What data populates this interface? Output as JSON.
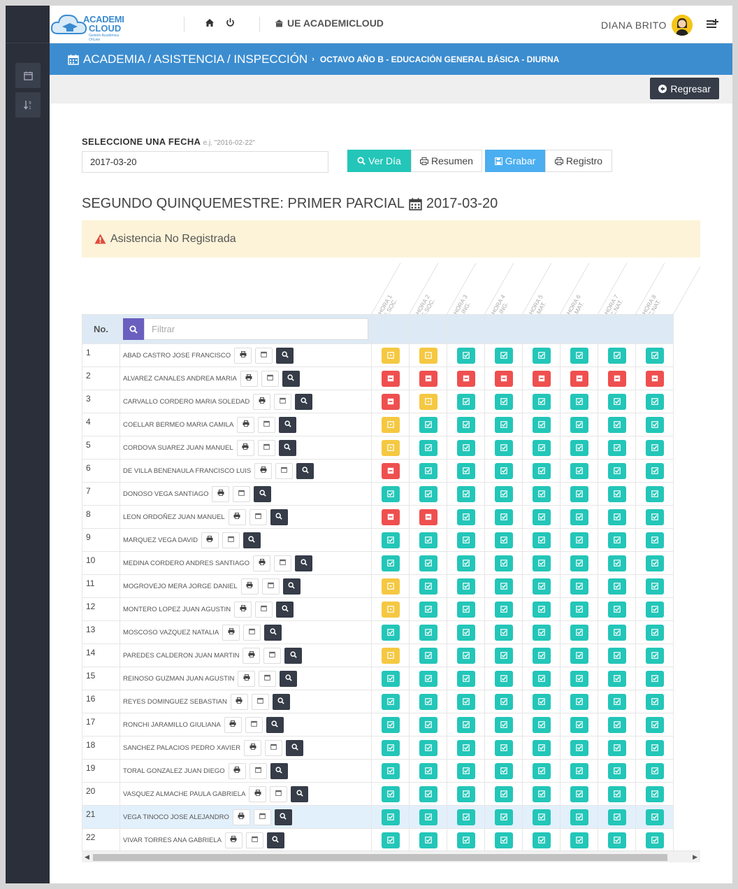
{
  "app": {
    "logo_line1": "ACADEMI",
    "logo_line2": "CLOUD",
    "logo_tagline": "Gestión Académica OnLine",
    "brand": "UE ACADEMICLOUD",
    "user": "DIANA BRITO"
  },
  "breadcrumb": {
    "main": "ACADEMIA / ASISTENCIA / INSPECCIÓN",
    "sub": "OCTAVO AÑO B - EDUCACIÓN GENERAL BÁSICA - DIURNA"
  },
  "toolbar": {
    "back_label": "Regresar"
  },
  "date_select": {
    "label": "SELECCIONE UNA FECHA",
    "hint": "e.j. \"2016-02-22\"",
    "value": "2017-03-20"
  },
  "buttons": {
    "ver_dia": "Ver Día",
    "resumen": "Resumen",
    "grabar": "Grabar",
    "registro": "Registro"
  },
  "section": {
    "title": "SEGUNDO QUINQUEMESTRE: PRIMER PARCIAL",
    "date": "2017-03-20"
  },
  "alert": {
    "text": "Asistencia No Registrada"
  },
  "table": {
    "col_no": "No.",
    "filter_placeholder": "Filtrar",
    "hours": [
      {
        "h": "HORA 1",
        "s": "E.SOC."
      },
      {
        "h": "HORA 2",
        "s": "E.SOC."
      },
      {
        "h": "HORA 3",
        "s": "ING."
      },
      {
        "h": "HORA 4",
        "s": "ING."
      },
      {
        "h": "HORA 5",
        "s": "MAT."
      },
      {
        "h": "HORA 6",
        "s": "MAT."
      },
      {
        "h": "HORA 7",
        "s": "C.NAT."
      },
      {
        "h": "HORA 8",
        "s": "C.NAT."
      }
    ],
    "rows": [
      {
        "no": "1",
        "name": "ABAD CASTRO JOSE FRANCISCO",
        "status": [
          "late",
          "late",
          "ok",
          "ok",
          "ok",
          "ok",
          "ok",
          "ok"
        ]
      },
      {
        "no": "2",
        "name": "ALVAREZ CANALES ANDREA MARIA",
        "status": [
          "abs",
          "abs",
          "abs",
          "abs",
          "abs",
          "abs",
          "abs",
          "abs"
        ]
      },
      {
        "no": "3",
        "name": "CARVALLO CORDERO MARIA SOLEDAD",
        "status": [
          "abs",
          "late",
          "ok",
          "ok",
          "ok",
          "ok",
          "ok",
          "ok"
        ]
      },
      {
        "no": "4",
        "name": "COELLAR BERMEO MARIA CAMILA",
        "status": [
          "late",
          "ok",
          "ok",
          "ok",
          "ok",
          "ok",
          "ok",
          "ok"
        ]
      },
      {
        "no": "5",
        "name": "CORDOVA SUAREZ JUAN MANUEL",
        "status": [
          "late",
          "ok",
          "ok",
          "ok",
          "ok",
          "ok",
          "ok",
          "ok"
        ]
      },
      {
        "no": "6",
        "name": "DE VILLA BENENAULA FRANCISCO LUIS",
        "status": [
          "abs",
          "ok",
          "ok",
          "ok",
          "ok",
          "ok",
          "ok",
          "ok"
        ]
      },
      {
        "no": "7",
        "name": "DONOSO VEGA SANTIAGO",
        "status": [
          "ok",
          "ok",
          "ok",
          "ok",
          "ok",
          "ok",
          "ok",
          "ok"
        ]
      },
      {
        "no": "8",
        "name": "LEON ORDOÑEZ JUAN MANUEL",
        "status": [
          "abs",
          "abs",
          "ok",
          "ok",
          "ok",
          "ok",
          "ok",
          "ok"
        ]
      },
      {
        "no": "9",
        "name": "MARQUEZ VEGA DAVID",
        "status": [
          "ok",
          "ok",
          "ok",
          "ok",
          "ok",
          "ok",
          "ok",
          "ok"
        ]
      },
      {
        "no": "10",
        "name": "MEDINA CORDERO ANDRES SANTIAGO",
        "status": [
          "ok",
          "ok",
          "ok",
          "ok",
          "ok",
          "ok",
          "ok",
          "ok"
        ]
      },
      {
        "no": "11",
        "name": "MOGROVEJO MERA JORGE DANIEL",
        "status": [
          "late",
          "ok",
          "ok",
          "ok",
          "ok",
          "ok",
          "ok",
          "ok"
        ]
      },
      {
        "no": "12",
        "name": "MONTERO LOPEZ JUAN AGUSTIN",
        "status": [
          "late",
          "ok",
          "ok",
          "ok",
          "ok",
          "ok",
          "ok",
          "ok"
        ]
      },
      {
        "no": "13",
        "name": "MOSCOSO VAZQUEZ NATALIA",
        "status": [
          "ok",
          "ok",
          "ok",
          "ok",
          "ok",
          "ok",
          "ok",
          "ok"
        ]
      },
      {
        "no": "14",
        "name": "PAREDES CALDERON JUAN MARTIN",
        "status": [
          "late",
          "ok",
          "ok",
          "ok",
          "ok",
          "ok",
          "ok",
          "ok"
        ]
      },
      {
        "no": "15",
        "name": "REINOSO GUZMAN JUAN AGUSTIN",
        "status": [
          "ok",
          "ok",
          "ok",
          "ok",
          "ok",
          "ok",
          "ok",
          "ok"
        ]
      },
      {
        "no": "16",
        "name": "REYES DOMINGUEZ SEBASTIAN",
        "status": [
          "ok",
          "ok",
          "ok",
          "ok",
          "ok",
          "ok",
          "ok",
          "ok"
        ]
      },
      {
        "no": "17",
        "name": "RONCHI JARAMILLO GIULIANA",
        "status": [
          "ok",
          "ok",
          "ok",
          "ok",
          "ok",
          "ok",
          "ok",
          "ok"
        ]
      },
      {
        "no": "18",
        "name": "SANCHEZ PALACIOS PEDRO XAVIER",
        "status": [
          "ok",
          "ok",
          "ok",
          "ok",
          "ok",
          "ok",
          "ok",
          "ok"
        ]
      },
      {
        "no": "19",
        "name": "TORAL GONZALEZ JUAN DIEGO",
        "status": [
          "ok",
          "ok",
          "ok",
          "ok",
          "ok",
          "ok",
          "ok",
          "ok"
        ]
      },
      {
        "no": "20",
        "name": "VASQUEZ ALMACHE PAULA GABRIELA",
        "status": [
          "ok",
          "ok",
          "ok",
          "ok",
          "ok",
          "ok",
          "ok",
          "ok"
        ]
      },
      {
        "no": "21",
        "name": "VEGA TINOCO JOSE ALEJANDRO",
        "status": [
          "ok",
          "ok",
          "ok",
          "ok",
          "ok",
          "ok",
          "ok",
          "ok"
        ],
        "highlight": true
      },
      {
        "no": "22",
        "name": "VIVAR TORRES ANA GABRIELA",
        "status": [
          "ok",
          "ok",
          "ok",
          "ok",
          "ok",
          "ok",
          "ok",
          "ok"
        ]
      }
    ]
  },
  "colors": {
    "accent_blue": "#3c8dd0",
    "present": "#23c6b8",
    "late": "#f5c842",
    "absent": "#ef4f4f",
    "sidebar": "#2b2f3a"
  }
}
